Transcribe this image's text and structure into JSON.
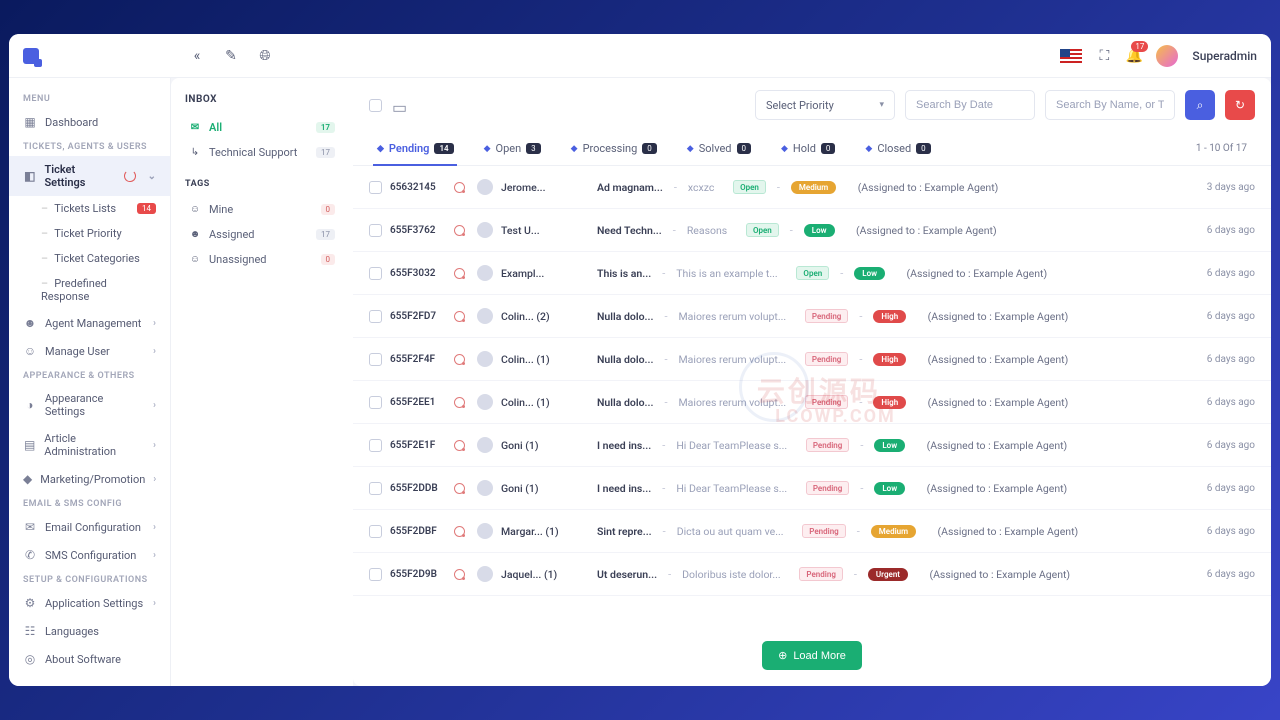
{
  "topbar": {
    "username": "Superadmin",
    "bell_count": "17"
  },
  "sidebar": {
    "sections": {
      "menu": "MENU",
      "tickets": "TICKETS, AGENTS & USERS",
      "appearance": "APPEARANCE & OTHERS",
      "email": "EMAIL & SMS CONFIG",
      "setup": "SETUP & CONFIGURATIONS"
    },
    "items": {
      "dashboard": "Dashboard",
      "ticket_settings": "Ticket Settings",
      "tickets_lists": "Tickets Lists",
      "tickets_lists_badge": "14",
      "ticket_priority": "Ticket Priority",
      "ticket_categories": "Ticket Categories",
      "predefined_response": "Predefined Response",
      "agent_management": "Agent Management",
      "manage_user": "Manage User",
      "appearance_settings": "Appearance Settings",
      "article_admin": "Article Administration",
      "marketing": "Marketing/Promotion",
      "email_config": "Email Configuration",
      "sms_config": "SMS Configuration",
      "app_settings": "Application Settings",
      "languages": "Languages",
      "about": "About Software"
    }
  },
  "inbox": {
    "title": "INBOX",
    "all": "All",
    "all_count": "17",
    "tech": "Technical Support",
    "tech_count": "17",
    "tags_title": "TAGS",
    "mine": "Mine",
    "mine_count": "0",
    "assigned": "Assigned",
    "assigned_count": "17",
    "unassigned": "Unassigned",
    "unassigned_count": "0"
  },
  "toolbar": {
    "select_priority": "Select Priority",
    "date_placeholder": "Search By Date",
    "name_placeholder": "Search By Name, or Ticket No"
  },
  "tabs": {
    "pending": "Pending",
    "pending_count": "14",
    "open": "Open",
    "open_count": "3",
    "processing": "Processing",
    "processing_count": "0",
    "solved": "Solved",
    "solved_count": "0",
    "hold": "Hold",
    "hold_count": "0",
    "closed": "Closed",
    "closed_count": "0",
    "pager": "1 - 10 Of 17"
  },
  "rows": [
    {
      "id": "65632145",
      "user": "Jerome...",
      "subject": "Ad magnam...",
      "sep": "-",
      "preview": "xcxzc",
      "status": "Open",
      "priority": "Medium",
      "assigned": "(Assigned to : Example Agent)",
      "time": "3 days ago"
    },
    {
      "id": "655F3762",
      "user": "Test U...",
      "subject": "Need Techn...",
      "sep": "-",
      "preview": "Reasons",
      "status": "Open",
      "priority": "Low",
      "assigned": "(Assigned to : Example Agent)",
      "time": "6 days ago"
    },
    {
      "id": "655F3032",
      "user": "Exampl...",
      "subject": "This is an...",
      "sep": "-",
      "preview": "This is an example t...",
      "status": "Open",
      "priority": "Low",
      "assigned": "(Assigned to : Example Agent)",
      "time": "6 days ago"
    },
    {
      "id": "655F2FD7",
      "user": "Colin... (2)",
      "subject": "Nulla dolo...",
      "sep": "-",
      "preview": "Maiores rerum volupt...",
      "status": "Pending",
      "priority": "High",
      "assigned": "(Assigned to : Example Agent)",
      "time": "6 days ago"
    },
    {
      "id": "655F2F4F",
      "user": "Colin... (1)",
      "subject": "Nulla dolo...",
      "sep": "-",
      "preview": "Maiores rerum volupt...",
      "status": "Pending",
      "priority": "High",
      "assigned": "(Assigned to : Example Agent)",
      "time": "6 days ago"
    },
    {
      "id": "655F2EE1",
      "user": "Colin... (1)",
      "subject": "Nulla dolo...",
      "sep": "-",
      "preview": "Maiores rerum volupt...",
      "status": "Pending",
      "priority": "High",
      "assigned": "(Assigned to : Example Agent)",
      "time": "6 days ago"
    },
    {
      "id": "655F2E1F",
      "user": "Goni (1)",
      "subject": "I need ins...",
      "sep": "-",
      "preview": "Hi Dear TeamPlease s...",
      "status": "Pending",
      "priority": "Low",
      "assigned": "(Assigned to : Example Agent)",
      "time": "6 days ago"
    },
    {
      "id": "655F2DDB",
      "user": "Goni (1)",
      "subject": "I need ins...",
      "sep": "-",
      "preview": "Hi Dear TeamPlease s...",
      "status": "Pending",
      "priority": "Low",
      "assigned": "(Assigned to : Example Agent)",
      "time": "6 days ago"
    },
    {
      "id": "655F2DBF",
      "user": "Margar... (1)",
      "subject": "Sint repre...",
      "sep": "-",
      "preview": "Dicta ou aut quam ve...",
      "status": "Pending",
      "priority": "Medium",
      "assigned": "(Assigned to : Example Agent)",
      "time": "6 days ago"
    },
    {
      "id": "655F2D9B",
      "user": "Jaquel... (1)",
      "subject": "Ut deserun...",
      "sep": "-",
      "preview": "Doloribus iste dolor...",
      "status": "Pending",
      "priority": "Urgent",
      "assigned": "(Assigned to : Example Agent)",
      "time": "6 days ago"
    }
  ],
  "loadmore": "Load More",
  "watermark": {
    "zh": "云创源码",
    "en": "LCOWP.COM"
  }
}
